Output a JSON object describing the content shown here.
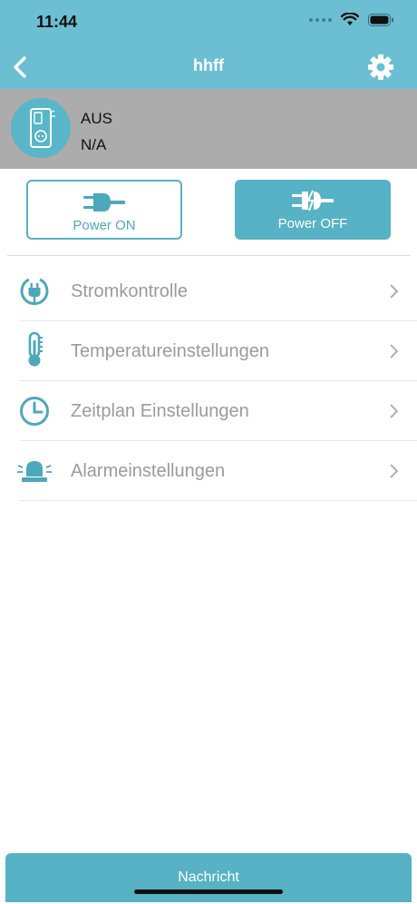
{
  "status_bar": {
    "time": "11:44"
  },
  "header": {
    "title": "hhff",
    "back_icon": "chevron-left-icon",
    "settings_icon": "gear-icon"
  },
  "device": {
    "status": "AUS",
    "value": "N/A"
  },
  "power": {
    "on_label": "Power ON",
    "off_label": "Power OFF"
  },
  "menu": {
    "items": [
      {
        "label": "Stromkontrolle",
        "icon": "power-plug-icon"
      },
      {
        "label": "Temperatureinstellungen",
        "icon": "thermometer-icon"
      },
      {
        "label": "Zeitplan Einstellungen",
        "icon": "clock-icon"
      },
      {
        "label": "Alarmeinstellungen",
        "icon": "alarm-light-icon"
      }
    ]
  },
  "bottom": {
    "label": "Nachricht"
  },
  "colors": {
    "accent": "#56b2c4",
    "header": "#6cbfd3",
    "panel": "#acacac",
    "menu_text": "#9b9b9b"
  }
}
